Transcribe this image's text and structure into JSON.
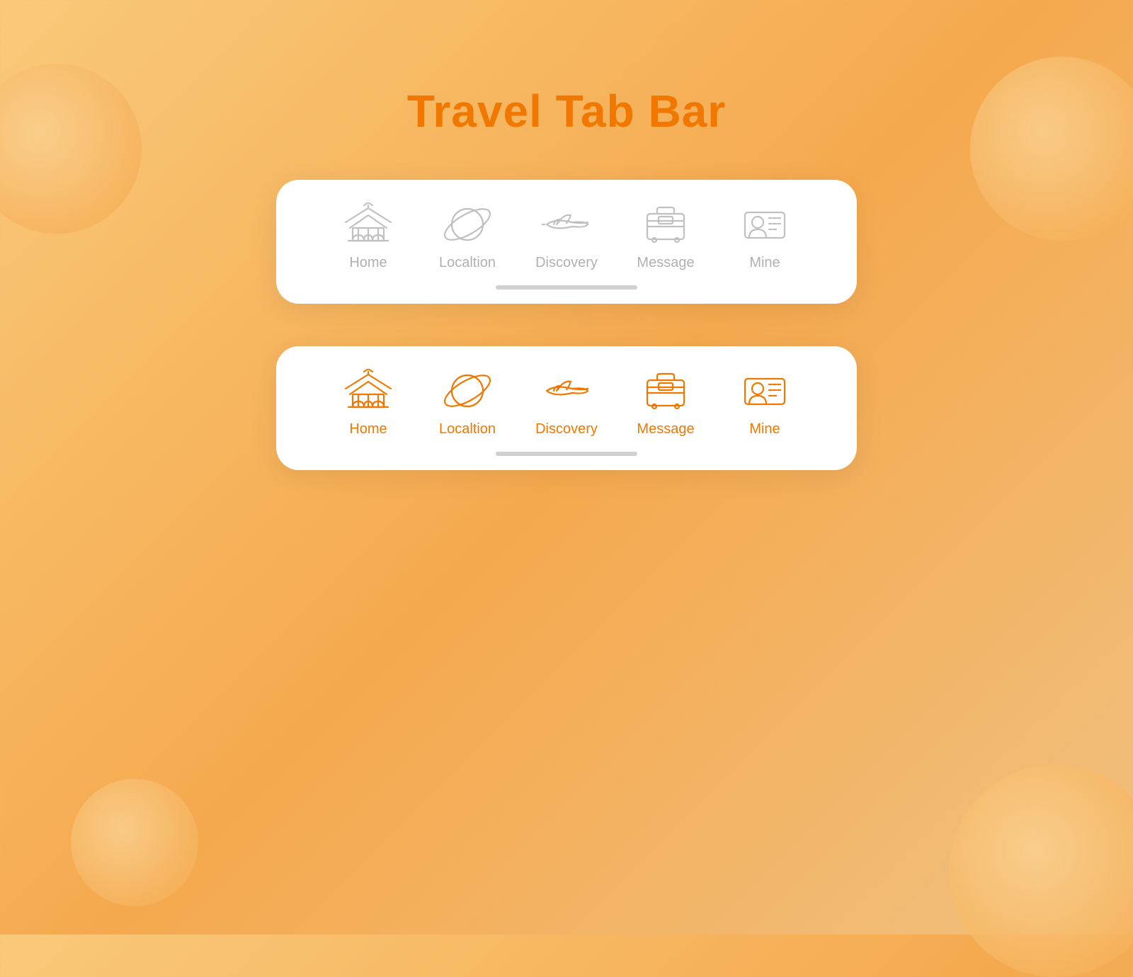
{
  "page": {
    "title": "Travel Tab Bar",
    "background_color": "#f5a94e",
    "accent_color": "#f07800",
    "inactive_color": "#c0c0c0"
  },
  "tab_bars": [
    {
      "id": "inactive",
      "state": "inactive",
      "items": [
        {
          "id": "home",
          "label": "Home"
        },
        {
          "id": "location",
          "label": "Localtion"
        },
        {
          "id": "discovery",
          "label": "Discovery"
        },
        {
          "id": "message",
          "label": "Message"
        },
        {
          "id": "mine",
          "label": "Mine"
        }
      ]
    },
    {
      "id": "active",
      "state": "active",
      "items": [
        {
          "id": "home",
          "label": "Home"
        },
        {
          "id": "location",
          "label": "Localtion"
        },
        {
          "id": "discovery",
          "label": "Discovery"
        },
        {
          "id": "message",
          "label": "Message"
        },
        {
          "id": "mine",
          "label": "Mine"
        }
      ]
    }
  ]
}
